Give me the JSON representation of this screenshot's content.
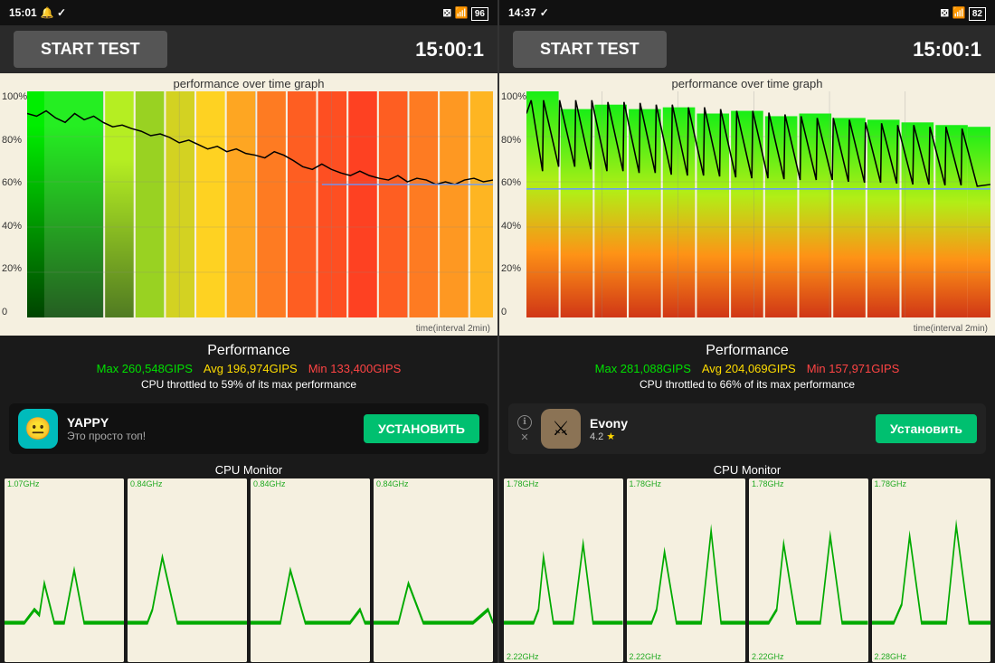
{
  "left_panel": {
    "status_bar": {
      "time": "15:01",
      "icons": "🔔 ✓"
    },
    "header": {
      "btn_label": "START TEST",
      "timer": "15:00:1"
    },
    "graph": {
      "title": "performance over time graph",
      "y_labels": [
        "100%",
        "80%",
        "60%",
        "40%",
        "20%",
        "0"
      ],
      "time_label": "time(interval 2min)"
    },
    "performance": {
      "title": "Performance",
      "max": "Max 260,548GIPS",
      "avg": "Avg 196,974GIPS",
      "min": "Min 133,400GIPS",
      "throttle": "CPU throttled to 59% of its max performance"
    },
    "ad": {
      "name": "YAPPY",
      "tagline": "Это просто топ!",
      "install_label": "УСТАНОВИТЬ"
    },
    "cpu_monitor": {
      "title": "CPU Monitor",
      "cores": [
        {
          "freq_top": "1.07GHz",
          "freq_bottom": ""
        },
        {
          "freq_top": "0.84GHz",
          "freq_bottom": ""
        },
        {
          "freq_top": "0.84GHz",
          "freq_bottom": ""
        },
        {
          "freq_top": "0.84GHz",
          "freq_bottom": ""
        }
      ]
    }
  },
  "right_panel": {
    "status_bar": {
      "time": "14:37",
      "icons": "✓"
    },
    "header": {
      "btn_label": "START TEST",
      "timer": "15:00:1"
    },
    "graph": {
      "title": "performance over time graph",
      "y_labels": [
        "100%",
        "80%",
        "60%",
        "40%",
        "20%",
        "0"
      ],
      "time_label": "time(interval 2min)"
    },
    "performance": {
      "title": "Performance",
      "max": "Max 281,088GIPS",
      "avg": "Avg 204,069GIPS",
      "min": "Min 157,971GIPS",
      "throttle": "CPU throttled to 66% of its max performance"
    },
    "ad": {
      "name": "Evony",
      "rating": "4.2 ★",
      "install_label": "Установить"
    },
    "cpu_monitor": {
      "title": "CPU Monitor",
      "cores": [
        {
          "freq_top": "1.78GHz",
          "freq_bottom": "2.22GHz"
        },
        {
          "freq_top": "1.78GHz",
          "freq_bottom": "2.22GHz"
        },
        {
          "freq_top": "1.78GHz",
          "freq_bottom": "2.22GHz"
        },
        {
          "freq_top": "1.78GHz",
          "freq_bottom": "2.28GHz"
        }
      ]
    }
  }
}
